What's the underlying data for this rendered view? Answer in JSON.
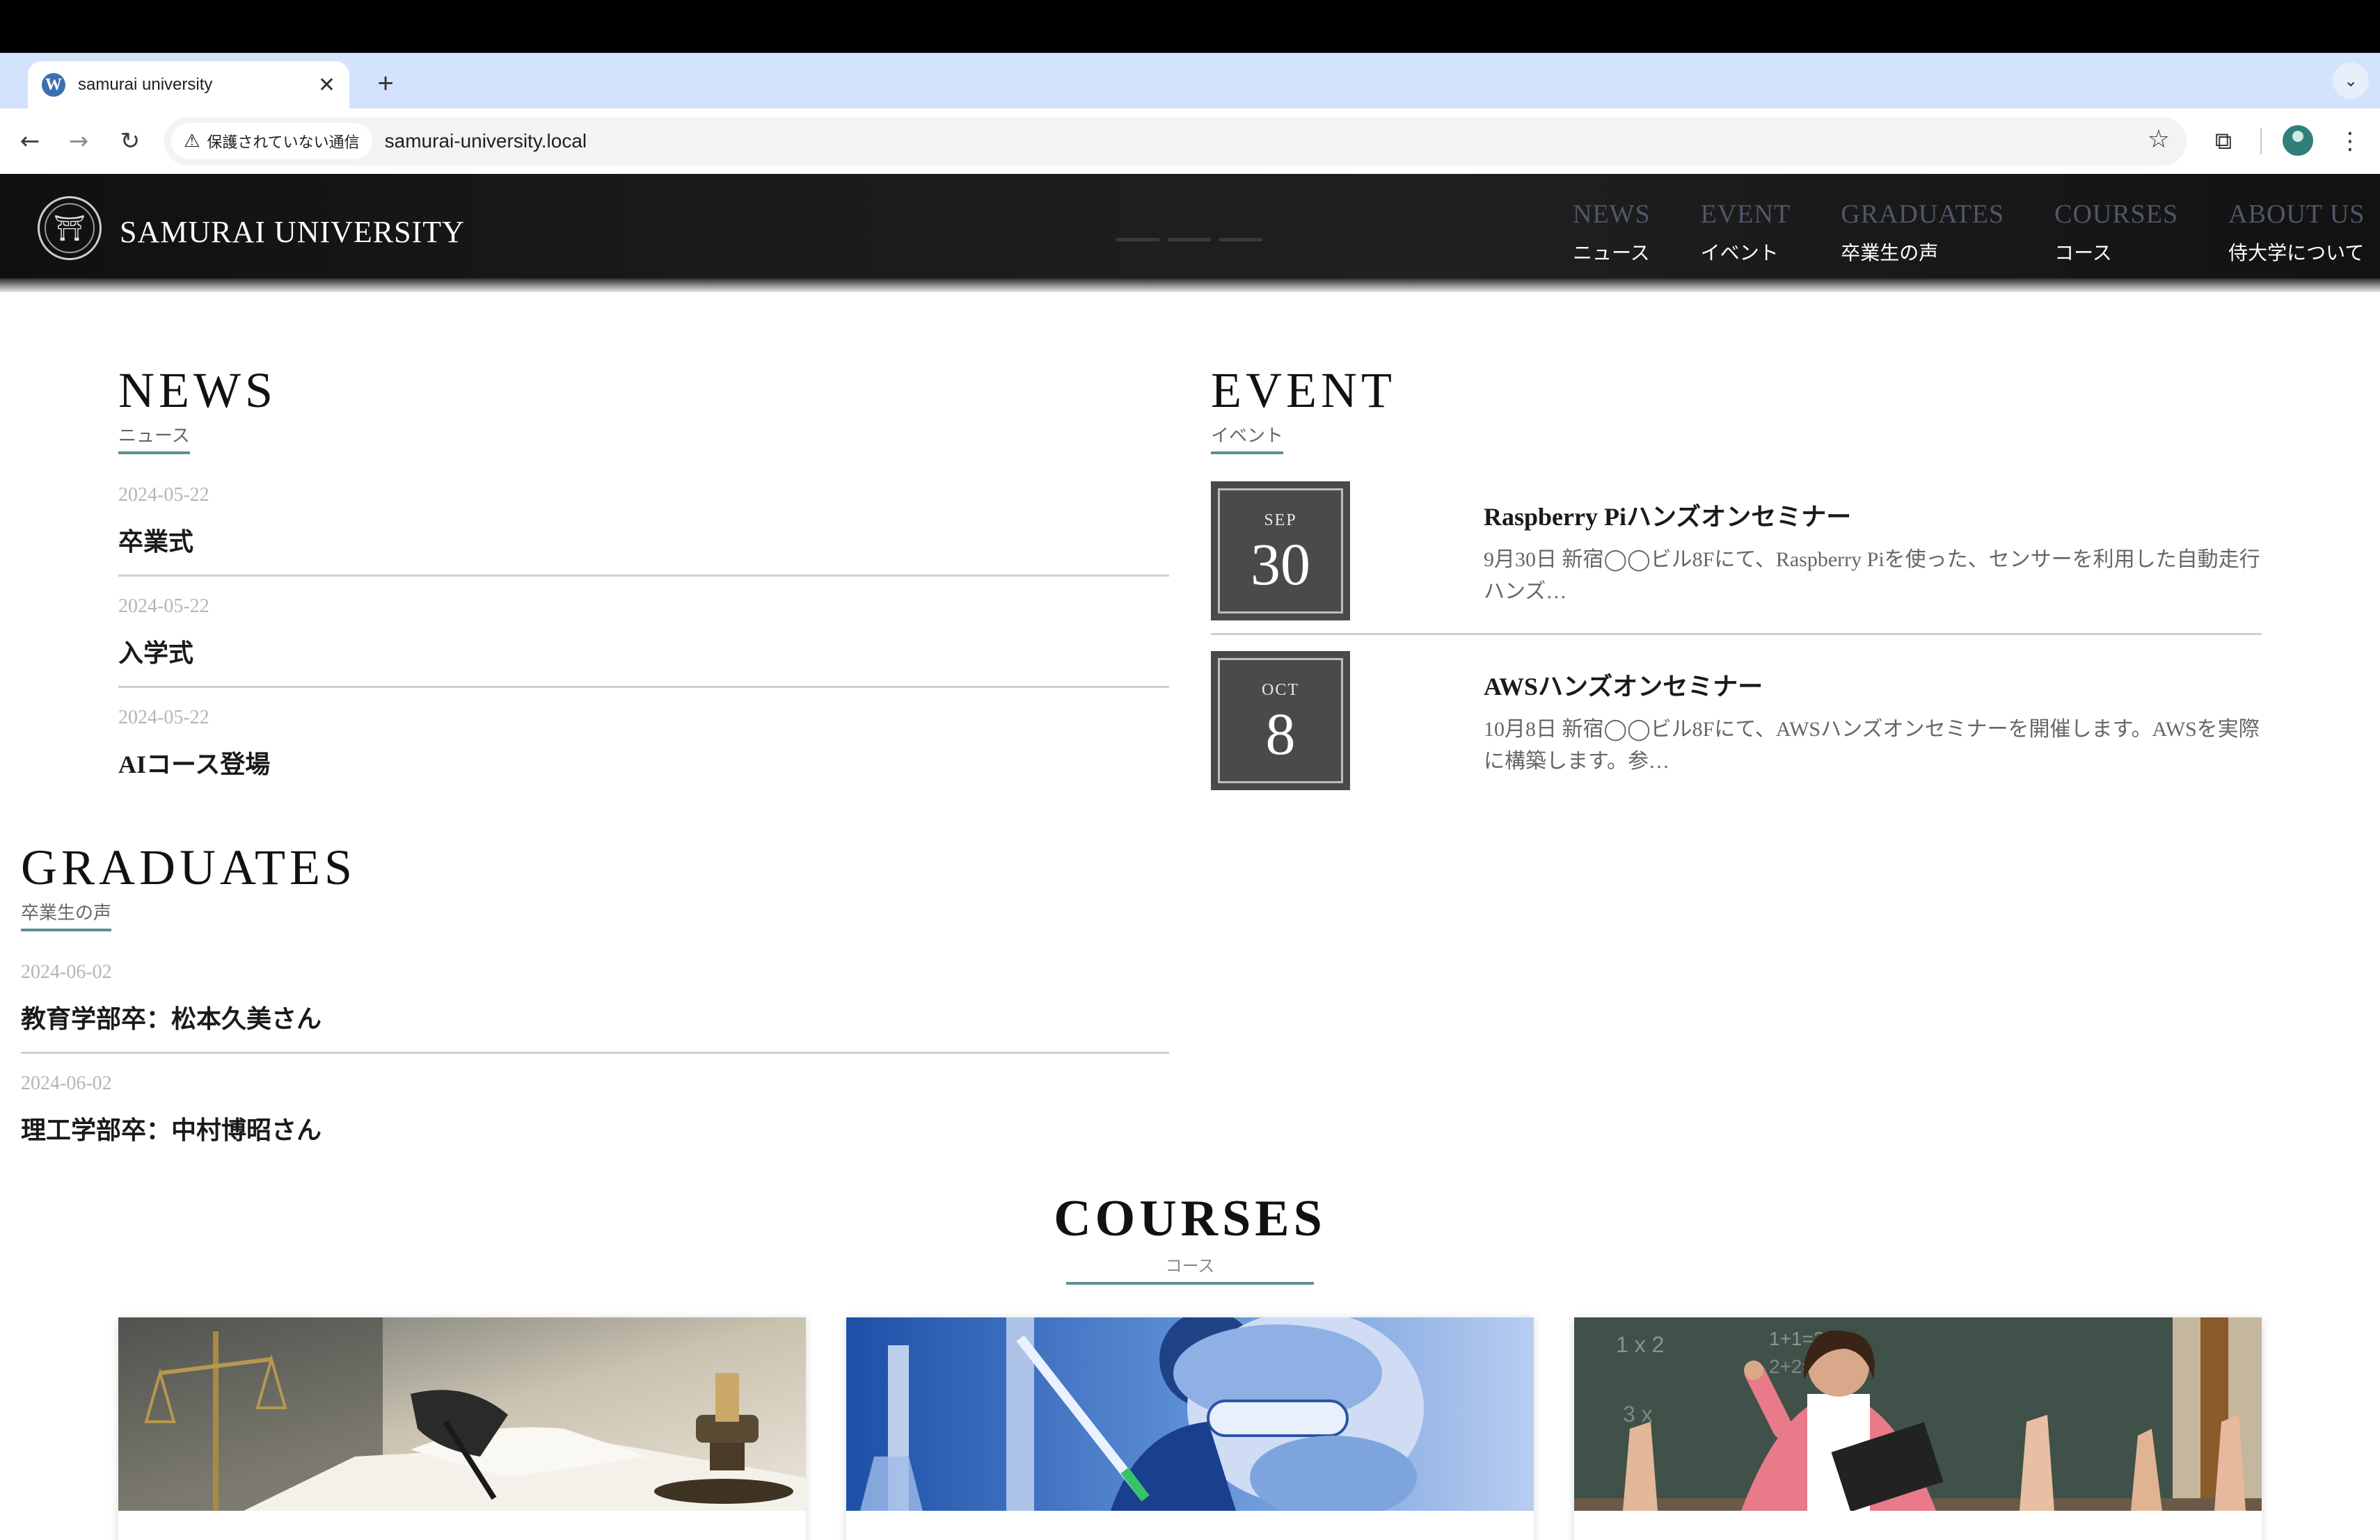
{
  "browser": {
    "tab_title": "samurai university",
    "tab_favicon": "wordpress-icon",
    "security_label": "保護されていない通信",
    "url": "samurai-university.local"
  },
  "site": {
    "title": "SAMURAI UNIVERSITY",
    "nav": [
      {
        "en": "NEWS",
        "ja": "ニュース"
      },
      {
        "en": "EVENT",
        "ja": "イベント"
      },
      {
        "en": "GRADUATES",
        "ja": "卒業生の声"
      },
      {
        "en": "COURSES",
        "ja": "コース"
      },
      {
        "en": "ABOUT US",
        "ja": "侍大学について"
      }
    ]
  },
  "news": {
    "title": "NEWS",
    "subtitle": "ニュース",
    "items": [
      {
        "date": "2024-05-22",
        "title": "卒業式"
      },
      {
        "date": "2024-05-22",
        "title": "入学式"
      },
      {
        "date": "2024-05-22",
        "title": "AIコース登場"
      }
    ]
  },
  "event": {
    "title": "EVENT",
    "subtitle": "イベント",
    "items": [
      {
        "month": "SEP",
        "day": "30",
        "title": "Raspberry Piハンズオンセミナー",
        "desc": "9月30日 新宿◯◯ビル8Fにて、Raspberry Piを使った、センサーを利用した自動走行ハンズ…"
      },
      {
        "month": "OCT",
        "day": "8",
        "title": "AWSハンズオンセミナー",
        "desc": "10月8日 新宿◯◯ビル8Fにて、AWSハンズオンセミナーを開催します。AWSを実際に構築します。参…"
      }
    ]
  },
  "graduates": {
    "title": "GRADUATES",
    "subtitle": "卒業生の声",
    "items": [
      {
        "date": "2024-06-02",
        "title": "教育学部卒：松本久美さん"
      },
      {
        "date": "2024-06-02",
        "title": "理工学部卒：中村博昭さん"
      }
    ]
  },
  "courses": {
    "title": "COURSES",
    "subtitle": "コース",
    "cards": [
      {
        "image": "law-scales-gavel-photo"
      },
      {
        "image": "science-lab-researcher-photo"
      },
      {
        "image": "classroom-teacher-photo"
      }
    ]
  },
  "colors": {
    "accent_underline": "#5c8f95",
    "header_bg": "#161616",
    "nav_en": "#4f5768",
    "date_box": "#4a4a4a"
  }
}
